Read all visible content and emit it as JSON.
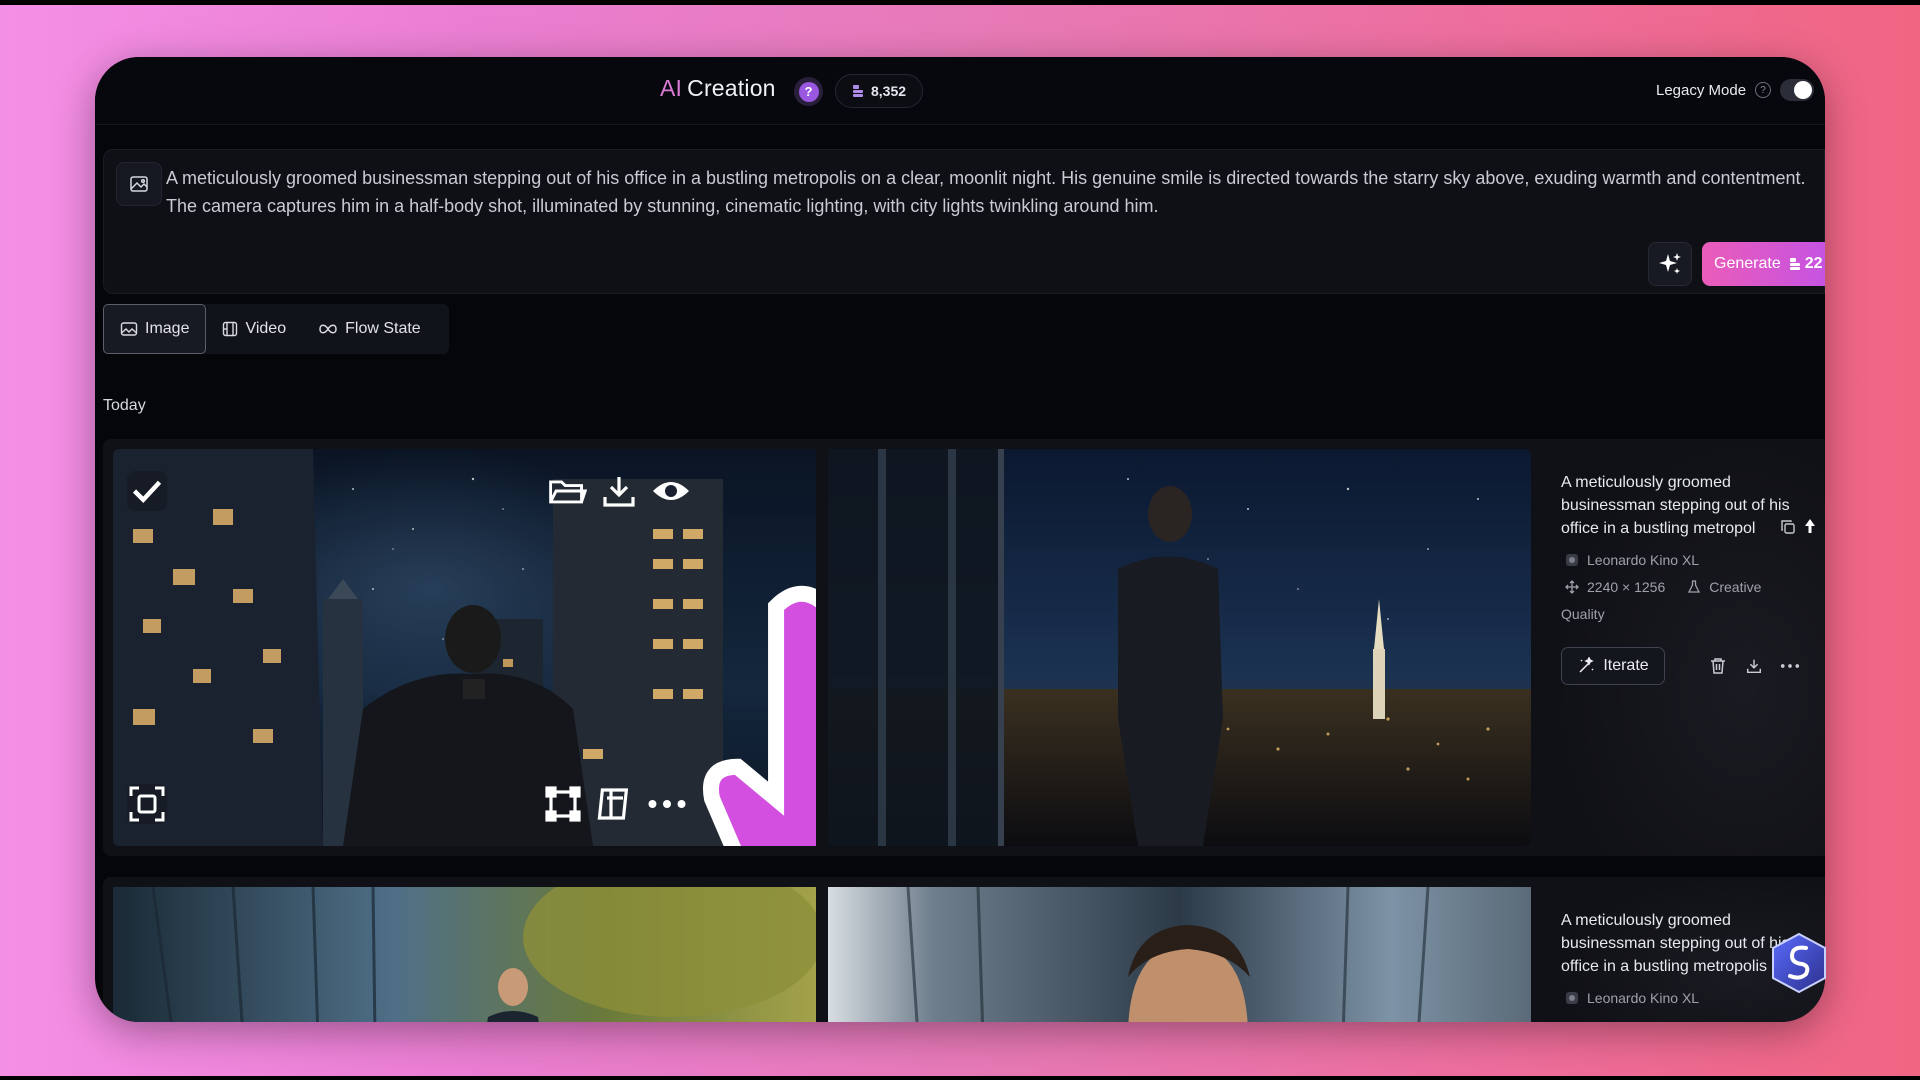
{
  "header": {
    "title_prefix": "AI",
    "title": "Creation",
    "help_badge": "?",
    "credits": "8,352",
    "legacy_mode_label": "Legacy Mode",
    "legacy_help": "?"
  },
  "prompt": {
    "text": "A meticulously groomed businessman stepping out of his office in a bustling metropolis on a clear, moonlit night. His genuine smile is directed towards the starry sky above, exuding warmth and contentment. The camera captures him in a half-body shot, illuminated by stunning, cinematic lighting, with city lights twinkling around him.",
    "generate_label": "Generate",
    "generate_cost": "22"
  },
  "tabs": [
    {
      "label": "Image",
      "active": true
    },
    {
      "label": "Video",
      "active": false
    },
    {
      "label": "Flow State",
      "active": false
    }
  ],
  "section_label": "Today",
  "generations": [
    {
      "desc_visible": "A meticulously groomed businessman stepping out of his office in a bustling metropol",
      "model": "Leonardo Kino XL",
      "dimensions": "2240 × 1256",
      "style": "Creative",
      "quality": "Quality",
      "iterate_label": "Iterate"
    },
    {
      "desc_visible": "A meticulously groomed businessman stepping out of his office in a bustling metropolis",
      "model": "Leonardo Kino XL"
    }
  ],
  "colors": {
    "accent_pink": "#ea5cb9",
    "accent_purple": "#c453e4",
    "background": "#05060a"
  },
  "icons": [
    "image-prompt-icon",
    "sparkle-icon",
    "credit-token-icon",
    "check-icon",
    "folder-icon",
    "download-icon",
    "eye-icon",
    "crop-icon",
    "frame-icon",
    "more-icon",
    "scan-icon",
    "copy-icon",
    "pin-icon",
    "trash-icon",
    "model-icon",
    "dimensions-icon",
    "flask-icon",
    "wand-icon",
    "cursor-hand-icon"
  ]
}
